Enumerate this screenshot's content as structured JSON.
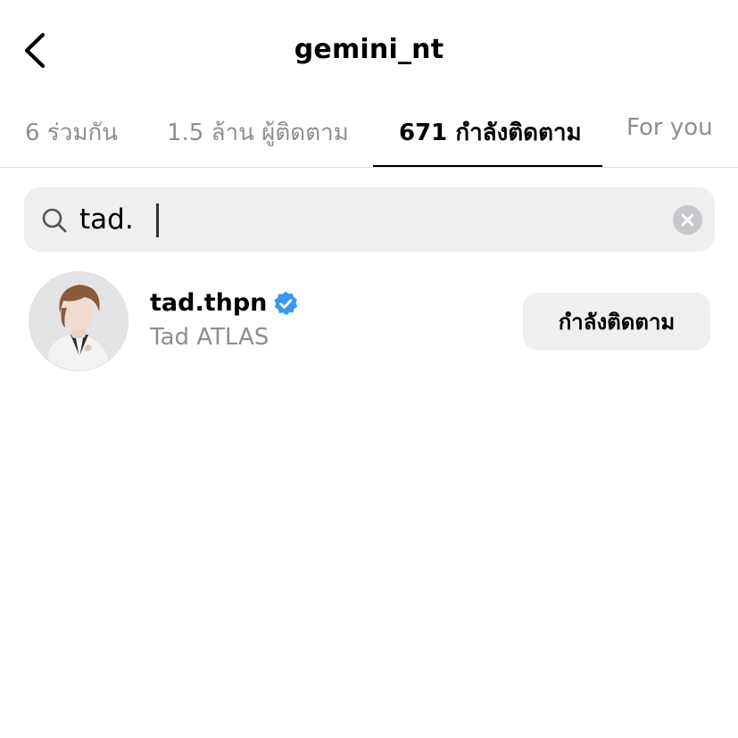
{
  "header": {
    "title": "gemini_nt",
    "back_icon": "chevron-left-icon"
  },
  "tabs": [
    {
      "label": "6 ร่วมกัน",
      "active": false
    },
    {
      "label": "1.5 ล้าน ผู้ติดตาม",
      "active": false
    },
    {
      "label": "671 กำลังติดตาม",
      "active": true
    },
    {
      "label": "For you",
      "active": false
    }
  ],
  "search": {
    "value": "tad.",
    "icon": "search-icon",
    "clear_icon": "clear-icon"
  },
  "results": [
    {
      "username": "tad.thpn",
      "verified": true,
      "full_name": "Tad ATLAS",
      "button_label": "กำลังติดตาม"
    }
  ],
  "colors": {
    "verified_badge": "#3897f0",
    "secondary_text": "#8e8e8e",
    "search_bg": "#efefef",
    "button_bg": "#efefef"
  }
}
